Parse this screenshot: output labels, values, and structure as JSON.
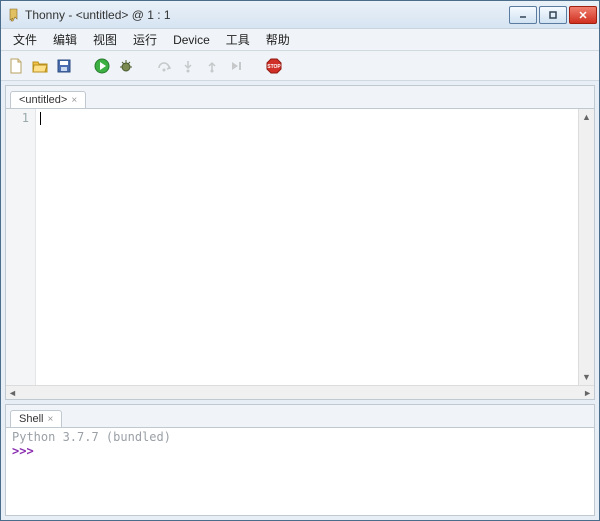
{
  "titlebar": {
    "text": "Thonny  -  <untitled>  @  1 : 1"
  },
  "menubar": {
    "items": [
      "文件",
      "编辑",
      "视图",
      "运行",
      "Device",
      "工具",
      "帮助"
    ]
  },
  "editor": {
    "tab_label": "<untitled>",
    "gutter_line": "1"
  },
  "shell": {
    "tab_label": "Shell",
    "banner": "Python 3.7.7 (bundled)",
    "prompt": ">>> "
  }
}
